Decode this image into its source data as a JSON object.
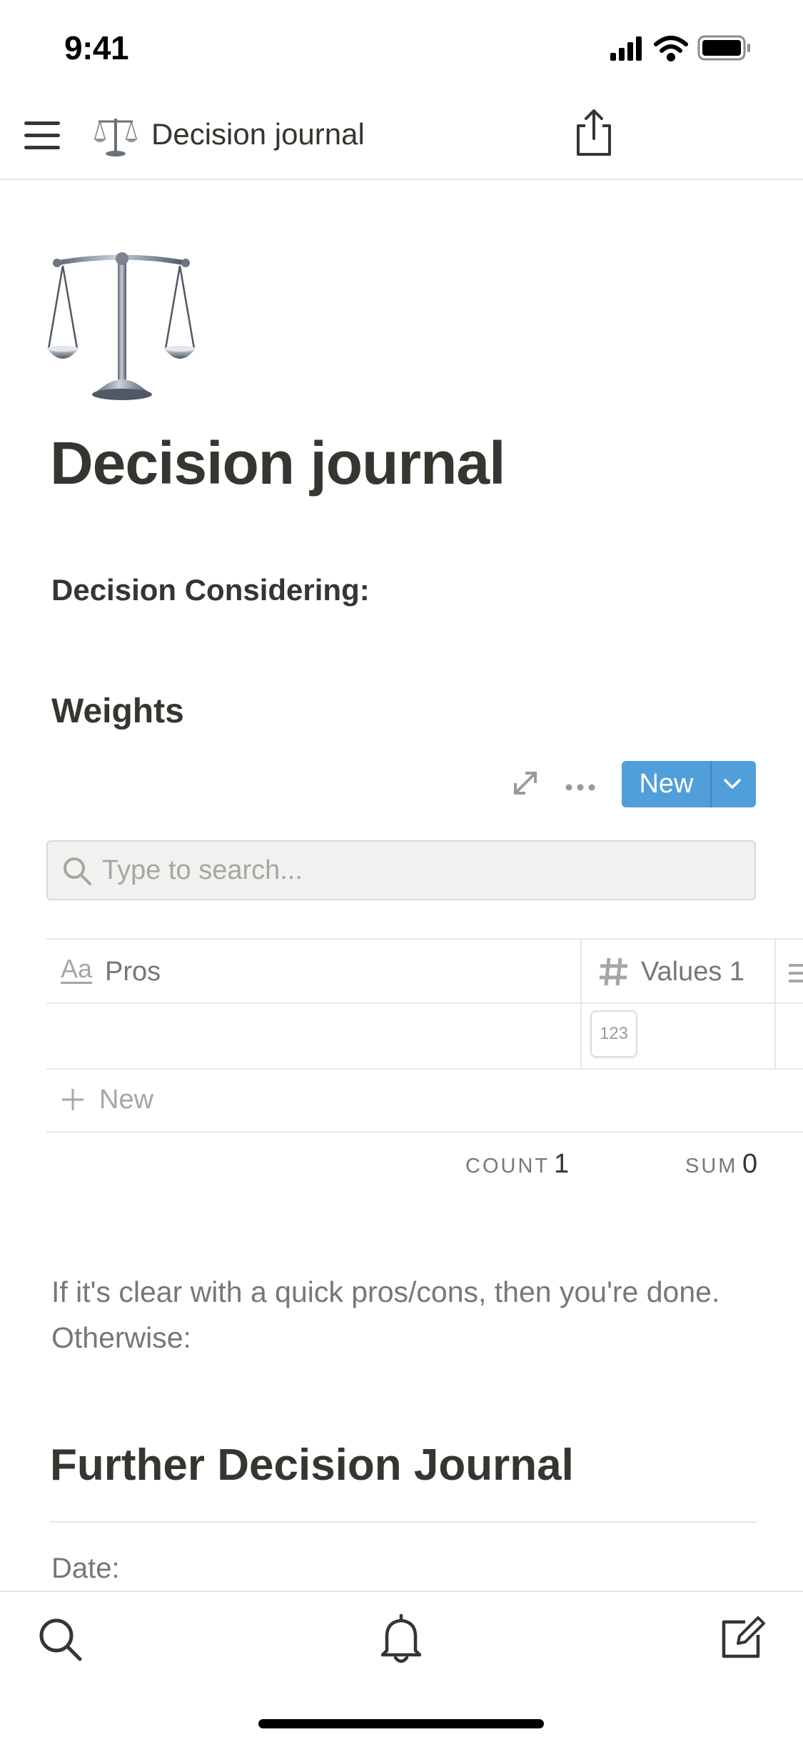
{
  "status_bar": {
    "time": "9:41"
  },
  "nav": {
    "title": "Decision journal",
    "page_emoji": "⚖️"
  },
  "page": {
    "icon": "balance-scale-emoji",
    "title": "Decision journal",
    "decision_label": "Decision Considering:",
    "weights_heading": "Weights"
  },
  "database": {
    "new_button_label": "New",
    "search_placeholder": "Type to search...",
    "columns": [
      {
        "icon": "text-property-icon",
        "icon_text": "Aa",
        "label": "Pros"
      },
      {
        "icon": "number-property-icon",
        "label": "Values 1"
      }
    ],
    "number_chip": "123",
    "new_row_label": "New",
    "aggregates": {
      "count_label": "COUNT",
      "count_value": "1",
      "sum_label": "SUM",
      "sum_value": "0"
    }
  },
  "body": {
    "paragraph": "If it's clear with a quick pros/cons, then you're done. Otherwise:",
    "further_heading": "Further Decision Journal",
    "date_label": "Date:"
  },
  "colors": {
    "accent_blue": "#509fdb",
    "text_primary": "#37352f",
    "text_secondary": "#787774"
  }
}
